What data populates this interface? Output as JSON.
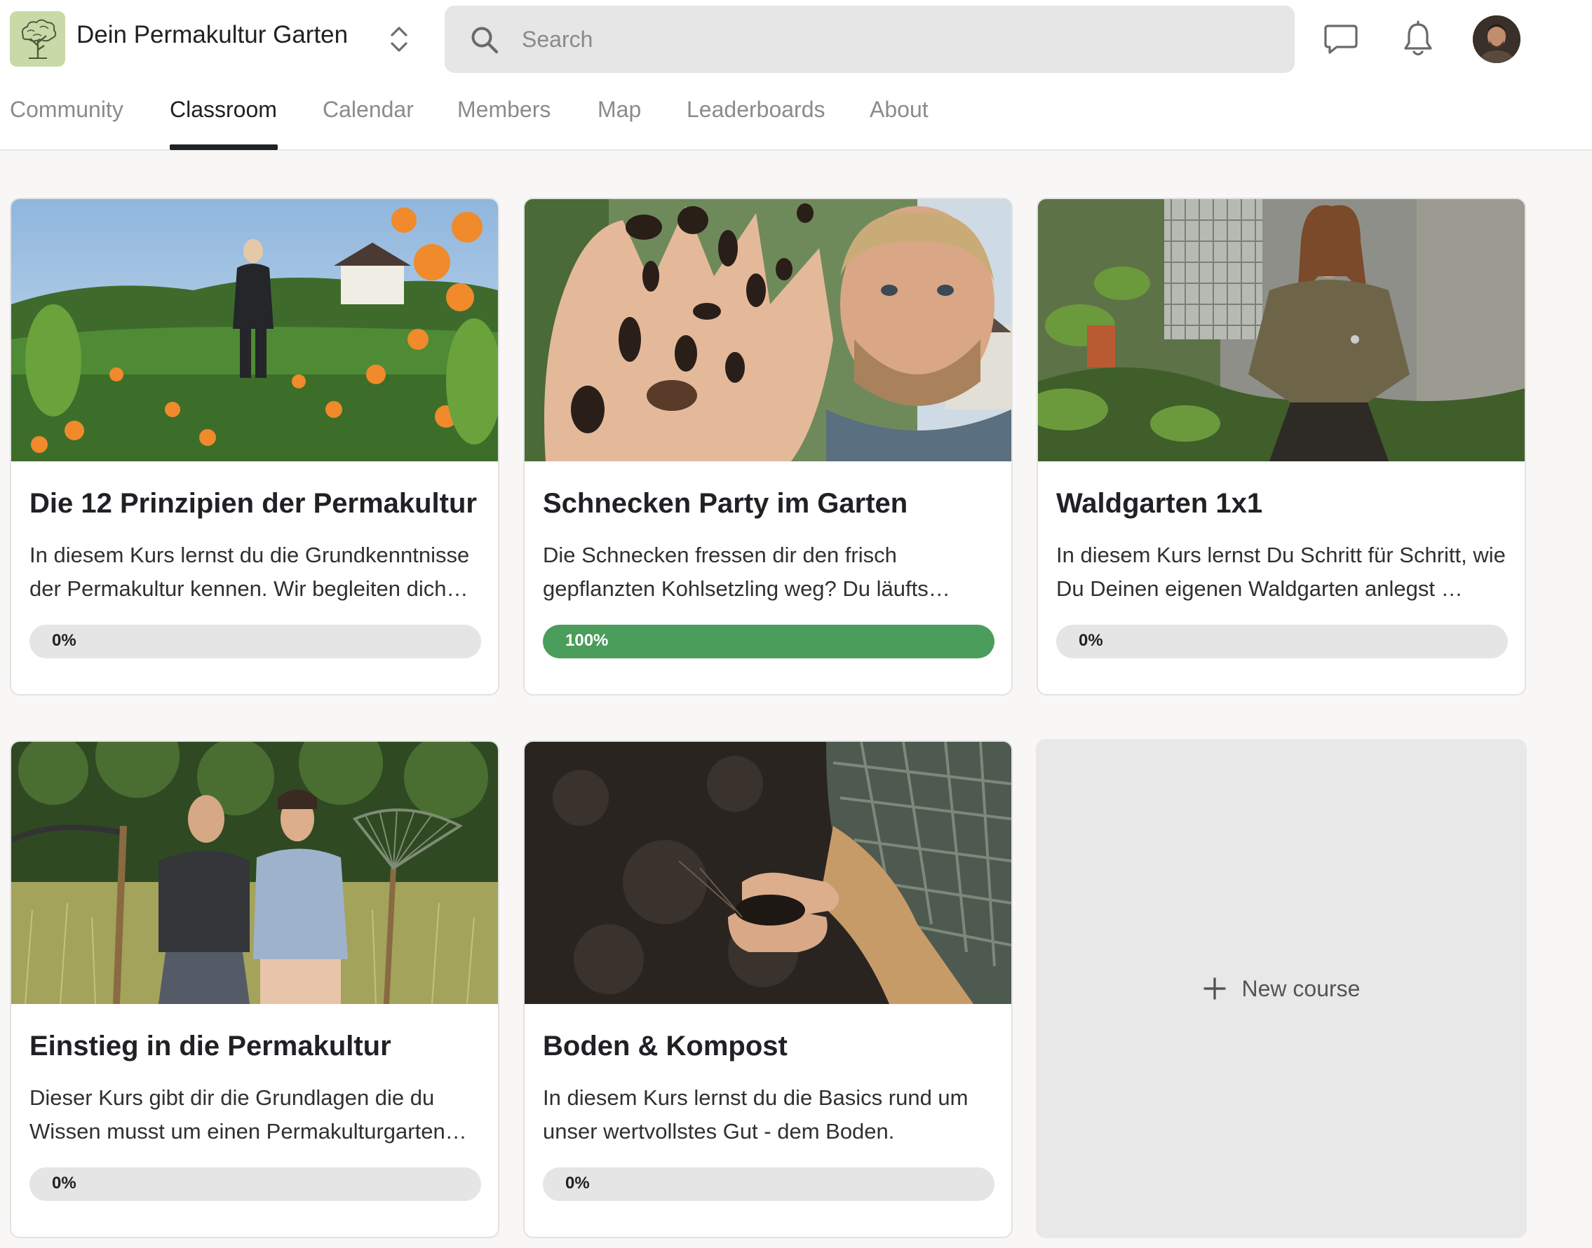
{
  "header": {
    "group_name": "Dein Permakultur Garten",
    "logo_icon": "tree-icon",
    "search_placeholder": "Search",
    "search_value": ""
  },
  "tabs": [
    {
      "label": "Community",
      "active": false
    },
    {
      "label": "Classroom",
      "active": true
    },
    {
      "label": "Calendar",
      "active": false
    },
    {
      "label": "Members",
      "active": false
    },
    {
      "label": "Map",
      "active": false
    },
    {
      "label": "Leaderboards",
      "active": false
    },
    {
      "label": "About",
      "active": false
    }
  ],
  "courses": [
    {
      "title": "Die 12 Prinzipien der Permakultur",
      "description": "In diesem Kurs lernst du die Grundkenntnisse der Permakultur kennen. Wir begleiten dich…",
      "progress": 0,
      "progress_label": "0%"
    },
    {
      "title": "Schnecken Party im Garten",
      "description": "Die Schnecken fressen dir den frisch gepflanzten Kohlsetzling weg? Du läufts…",
      "progress": 100,
      "progress_label": "100%"
    },
    {
      "title": "Waldgarten 1x1",
      "description": "In diesem Kurs lernst Du Schritt für Schritt, wie Du Deinen eigenen Waldgarten anlegst …",
      "progress": 0,
      "progress_label": "0%"
    },
    {
      "title": "Einstieg in die Permakultur",
      "description": "Dieser Kurs gibt dir die Grundlagen die du Wissen musst um einen Permakulturgarten…",
      "progress": 0,
      "progress_label": "0%"
    },
    {
      "title": "Boden & Kompost",
      "description": "In diesem Kurs lernst du die Basics rund um unser wertvollstes Gut - dem Boden.",
      "progress": 0,
      "progress_label": "0%"
    }
  ],
  "new_course": {
    "label": "New course"
  },
  "colors": {
    "progress_complete": "#4a9d5b",
    "progress_track": "#e5e5e5",
    "accent_text": "#202124"
  }
}
